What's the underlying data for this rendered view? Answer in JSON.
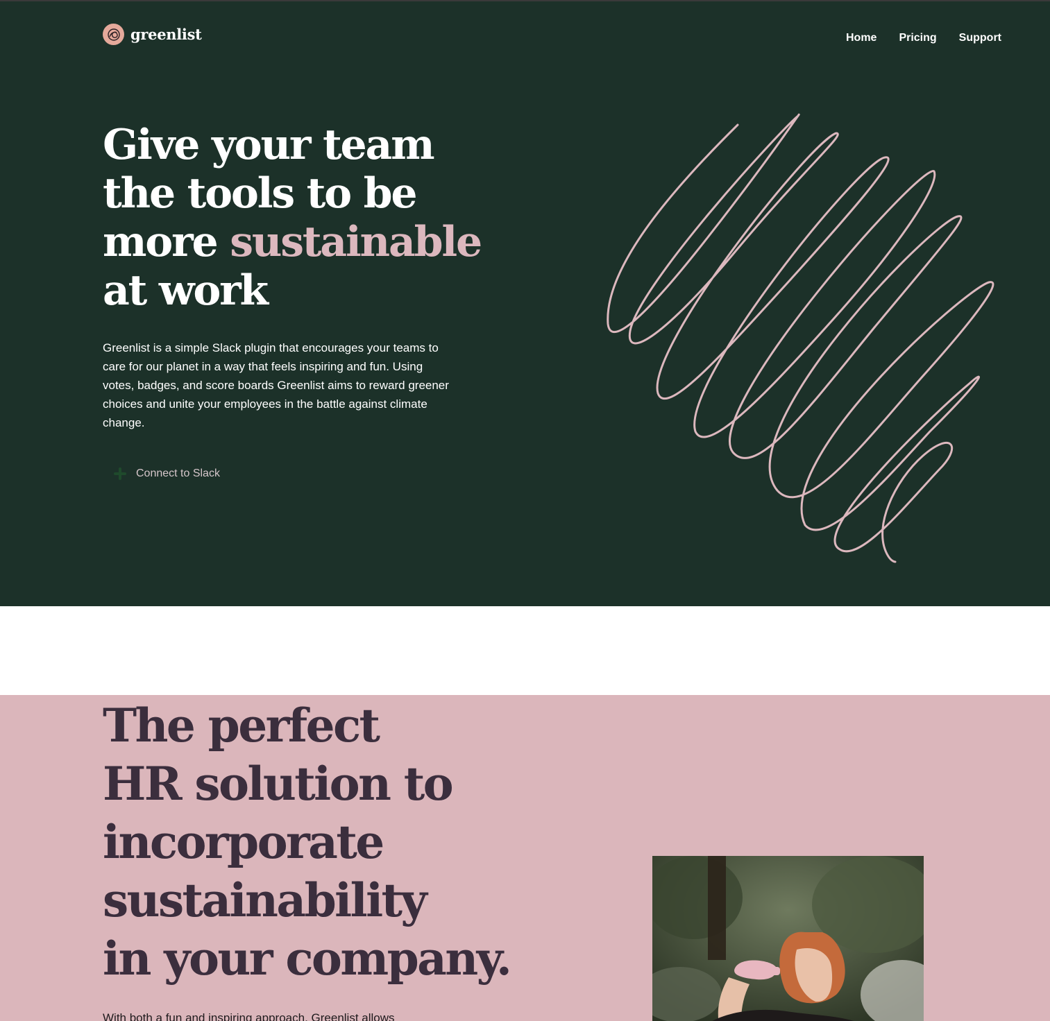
{
  "brand": {
    "name": "greenlist",
    "logo_icon": "leaf-knot-icon"
  },
  "nav": {
    "items": [
      "Home",
      "Pricing",
      "Support"
    ]
  },
  "hero": {
    "title_line1": "Give your team",
    "title_line2": "the tools to be",
    "title_line3_prefix": "more ",
    "title_accent": "sustainable",
    "title_line4": "at work",
    "description": "Greenlist is a simple Slack plugin that encourages your teams to care for our planet in a way that feels inspiring and fun. Using votes, badges, and score boards Greenlist aims to reward greener choices and unite your employees in the battle against climate change.",
    "cta_label": "Connect to Slack",
    "cta_icon": "slack-icon"
  },
  "section2": {
    "title_lines": [
      "The perfect",
      "HR solution to",
      "incorporate",
      "sustainability",
      "in your company."
    ],
    "description_start": "With both a fun and inspiring approach, Greenlist allows",
    "image": "woman-drinking-from-pink-bottle"
  },
  "colors": {
    "hero_bg": "#1c3129",
    "accent_pink": "#dcb8be",
    "logo_badge": "#e5a99b",
    "section2_bg": "#dbb6bb",
    "section2_text": "#3b2e3d"
  }
}
